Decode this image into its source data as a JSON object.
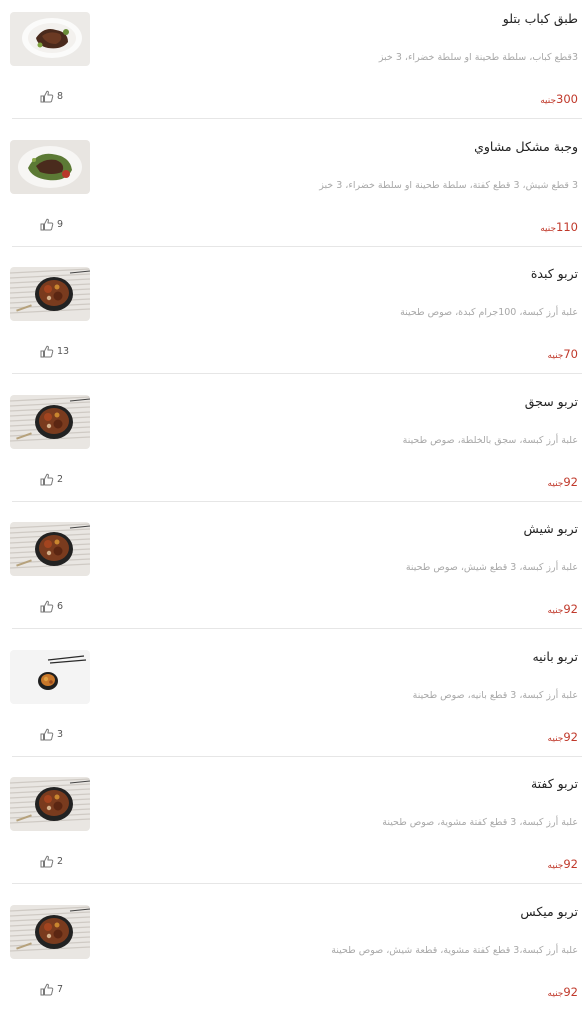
{
  "currency": "جنيه",
  "items": [
    {
      "title": "طبق كباب بتلو",
      "description": "3قطع كباب، سلطة طحينة او سلطة خضراء، 3 خبز",
      "price": "300",
      "likes": "8",
      "photo_style": "plate-white-meat"
    },
    {
      "title": "وجبة مشكل مشاوي",
      "description": "3 قطع شيش، 3 قطع كفتة، سلطة طحينة او سلطة خضراء، 3 خبز",
      "price": "110",
      "likes": "9",
      "photo_style": "plate-white-greens"
    },
    {
      "title": "تربو كبدة",
      "description": "علبة أرز كبسة، 100جرام كبدة، صوص طحينة",
      "price": "70",
      "likes": "13",
      "photo_style": "bowl-dark-napkin"
    },
    {
      "title": "تربو سجق",
      "description": "علبة أرز كبسة، سجق بالخلطة، صوص طحينة",
      "price": "92",
      "likes": "2",
      "photo_style": "bowl-dark-napkin"
    },
    {
      "title": "تربو شيش",
      "description": "علبة أرز كبسة، 3 قطع شيش، صوص طحينة",
      "price": "92",
      "likes": "6",
      "photo_style": "bowl-dark-napkin"
    },
    {
      "title": "تربو بانيه",
      "description": "علبة أرز كبسة، 3 قطع بانيه، صوص طحينة",
      "price": "92",
      "likes": "3",
      "photo_style": "bowl-small-white"
    },
    {
      "title": "تربو كفتة",
      "description": "علبة أرز كبسة، 3 قطع كفتة مشوية، صوص طحينة",
      "price": "92",
      "likes": "2",
      "photo_style": "bowl-dark-napkin"
    },
    {
      "title": "تربو ميكس",
      "description": "علبة أرز كبسة،3 قطع كفتة مشوية، قطعة شيش، صوص طحينة",
      "price": "92",
      "likes": "7",
      "photo_style": "bowl-dark-napkin"
    }
  ]
}
